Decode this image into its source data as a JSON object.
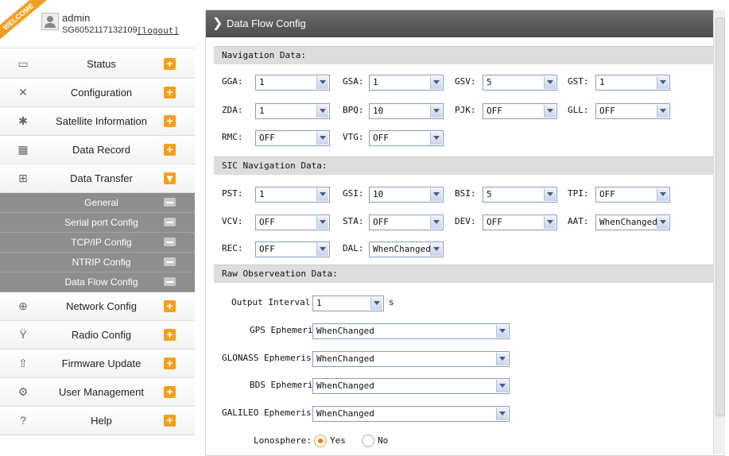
{
  "user": {
    "welcome": "WELCOME",
    "name": "admin",
    "serial": "SG6052117132109",
    "logout": "[logout]"
  },
  "nav": {
    "status": "Status",
    "configuration": "Configuration",
    "satellite": "Satellite Information",
    "record": "Data Record",
    "transfer": "Data Transfer",
    "sub_general": "General",
    "sub_serial": "Serial port Config",
    "sub_tcpip": "TCP/IP Config",
    "sub_ntrip": "NTRIP Config",
    "sub_dataflow": "Data Flow Config",
    "network": "Network Config",
    "radio": "Radio Config",
    "firmware": "Firmware Update",
    "users": "User Management",
    "help": "Help"
  },
  "page": {
    "title": "Data Flow Config"
  },
  "nav_data": {
    "title": "Navigation Data:",
    "gga_l": "GGA:",
    "gga": "1",
    "gsa_l": "GSA:",
    "gsa": "1",
    "gsv_l": "GSV:",
    "gsv": "5",
    "gst_l": "GST:",
    "gst": "1",
    "zda_l": "ZDA:",
    "zda": "1",
    "bpq_l": "BPQ:",
    "bpq": "10",
    "pjk_l": "PJK:",
    "pjk": "OFF",
    "gll_l": "GLL:",
    "gll": "OFF",
    "rmc_l": "RMC:",
    "rmc": "OFF",
    "vtg_l": "VTG:",
    "vtg": "OFF"
  },
  "sic_data": {
    "title": "SIC Navigation Data:",
    "pst_l": "PST:",
    "pst": "1",
    "gsi_l": "GSI:",
    "gsi": "10",
    "bsi_l": "BSI:",
    "bsi": "5",
    "tpi_l": "TPI:",
    "tpi": "OFF",
    "vcv_l": "VCV:",
    "vcv": "OFF",
    "sta_l": "STA:",
    "sta": "OFF",
    "dev_l": "DEV:",
    "dev": "OFF",
    "aat_l": "AAT:",
    "aat": "WhenChanged",
    "rec_l": "REC:",
    "rec": "OFF",
    "dal_l": "DAL:",
    "dal": "WhenChanged"
  },
  "raw_data": {
    "title": "Raw Observeation Data:",
    "interval_l": "Output Interval:",
    "interval": "1",
    "interval_unit": "s",
    "gps_l": "GPS Ephemeris:",
    "gps": "WhenChanged",
    "glonass_l": "GLONASS Ephemeris:",
    "glonass": "WhenChanged",
    "bds_l": "BDS Ephemeris:",
    "bds": "WhenChanged",
    "galileo_l": "GALILEO Ephemeris:",
    "galileo": "WhenChanged",
    "iono_l": "Lonosphere:",
    "iono_yes": "Yes",
    "iono_no": "No",
    "iono_selected": "Yes"
  }
}
